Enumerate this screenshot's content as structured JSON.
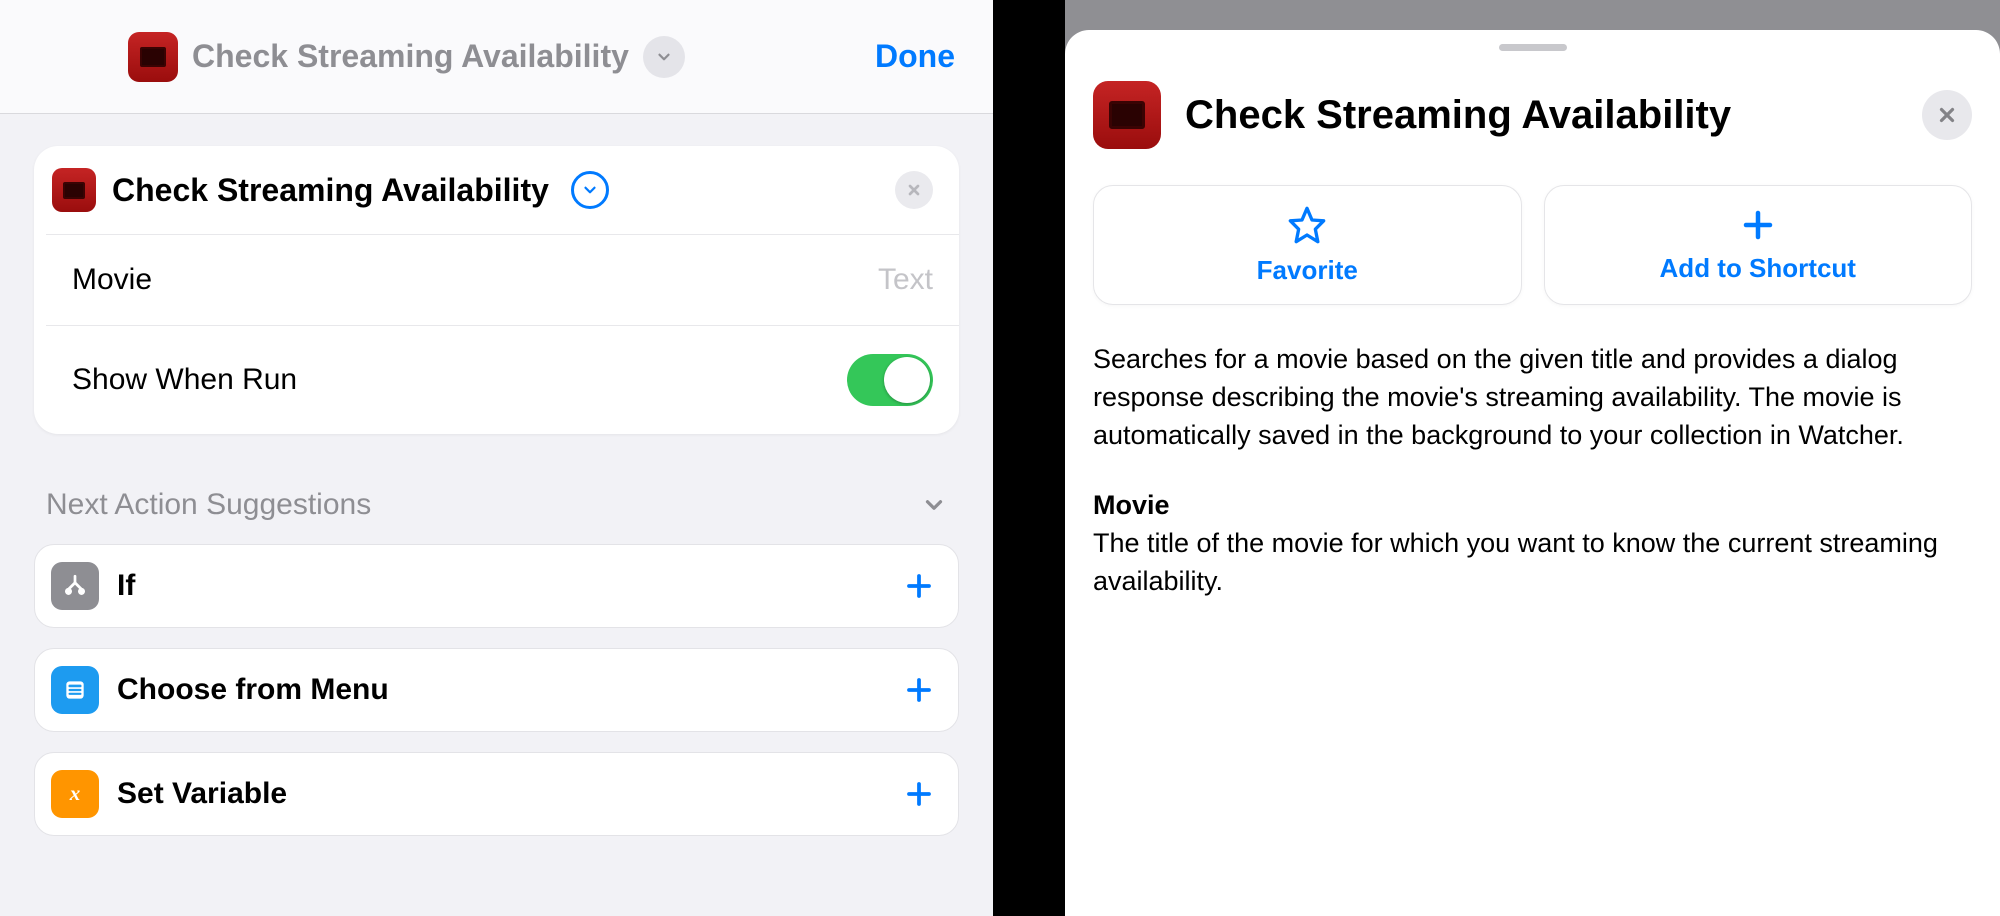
{
  "topbar": {
    "title": "Check Streaming Availability",
    "done": "Done"
  },
  "action": {
    "title": "Check Streaming Availability",
    "rows": {
      "movie_label": "Movie",
      "movie_placeholder": "Text",
      "show_when_run": "Show When Run"
    }
  },
  "suggestions": {
    "heading": "Next Action Suggestions",
    "items": [
      {
        "label": "If"
      },
      {
        "label": "Choose from Menu"
      },
      {
        "label": "Set Variable"
      }
    ]
  },
  "info": {
    "title": "Check Streaming Availability",
    "favorite": "Favorite",
    "add_to_shortcut": "Add to Shortcut",
    "description": "Searches for a movie based on the given title and provides a dialog response describing the movie's streaming availability. The movie is automatically saved in the background to your collection in Watcher.",
    "param_name": "Movie",
    "param_desc": "The title of the movie for which you want to know the current streaming availability."
  }
}
